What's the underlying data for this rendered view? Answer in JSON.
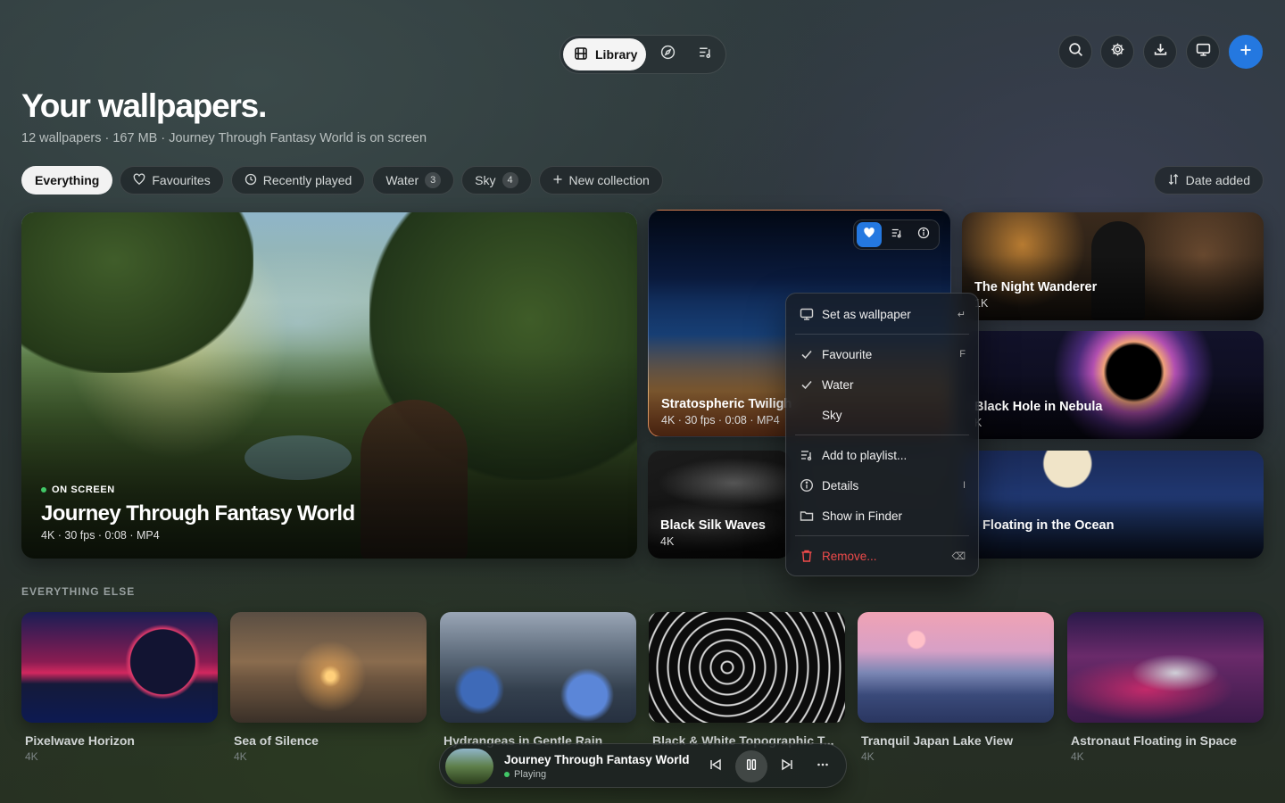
{
  "nav": {
    "library_label": "Library",
    "tabs": [
      {
        "name": "library",
        "icon": "film-icon"
      },
      {
        "name": "explore",
        "icon": "compass-icon"
      },
      {
        "name": "playlists",
        "icon": "playlist-icon"
      }
    ]
  },
  "toolbar": {
    "icons": [
      "search-icon",
      "gear-icon",
      "download-icon",
      "display-icon",
      "plus-icon"
    ]
  },
  "header": {
    "title": "Your wallpapers.",
    "subtitle": "12 wallpapers · 167 MB · Journey Through Fantasy World is on screen"
  },
  "filters": {
    "chips": [
      {
        "label": "Everything",
        "active": true
      },
      {
        "label": "Favourites",
        "icon": "heart-icon"
      },
      {
        "label": "Recently played",
        "icon": "clock-icon"
      },
      {
        "label": "Water",
        "count": "3"
      },
      {
        "label": "Sky",
        "count": "4"
      },
      {
        "label": "New collection",
        "icon": "plus-icon"
      }
    ],
    "sort_label": "Date added"
  },
  "featured": {
    "badge": "ON SCREEN",
    "title": "Journey Through Fantasy World",
    "meta": "4K · 30 fps · 0:08 · MP4"
  },
  "grid": {
    "stratospheric": {
      "title": "Stratospheric Twiligh",
      "meta": "4K · 30 fps · 0:08 · MP4"
    },
    "silk": {
      "title": "Black Silk Waves",
      "meta": "4K"
    },
    "night": {
      "title": "The Night Wanderer",
      "meta": "1K"
    },
    "blackhole": {
      "title": "Black Hole in Nebula",
      "meta": "K"
    },
    "ocean": {
      "title": "Floating in the Ocean",
      "meta": ""
    }
  },
  "context_menu": {
    "items": [
      {
        "label": "Set as wallpaper",
        "shortcut": "↵",
        "icon": "display-icon"
      },
      {
        "label": "Favourite",
        "shortcut": "F",
        "checked": true
      },
      {
        "label": "Water",
        "checked": true
      },
      {
        "label": "Sky",
        "checked": false
      },
      {
        "label": "Add to playlist...",
        "icon": "playlist-icon"
      },
      {
        "label": "Details",
        "shortcut": "I",
        "icon": "info-icon"
      },
      {
        "label": "Show in Finder",
        "icon": "folder-icon"
      },
      {
        "label": "Remove...",
        "shortcut": "⌫",
        "icon": "trash-icon",
        "danger": true
      }
    ]
  },
  "section_label": "EVERYTHING ELSE",
  "others": [
    {
      "title": "Pixelwave Horizon",
      "meta": "4K"
    },
    {
      "title": "Sea of Silence",
      "meta": "4K"
    },
    {
      "title": "Hydrangeas in Gentle Rain",
      "meta": ""
    },
    {
      "title": "Black & White Topographic T...",
      "meta": ""
    },
    {
      "title": "Tranquil Japan Lake View",
      "meta": "4K"
    },
    {
      "title": "Astronaut Floating in Space",
      "meta": "4K"
    }
  ],
  "player": {
    "title": "Journey Through Fantasy World",
    "status": "Playing"
  },
  "colors": {
    "accent": "#2478e0",
    "danger": "#ef4b4b",
    "playing": "#41c767"
  }
}
